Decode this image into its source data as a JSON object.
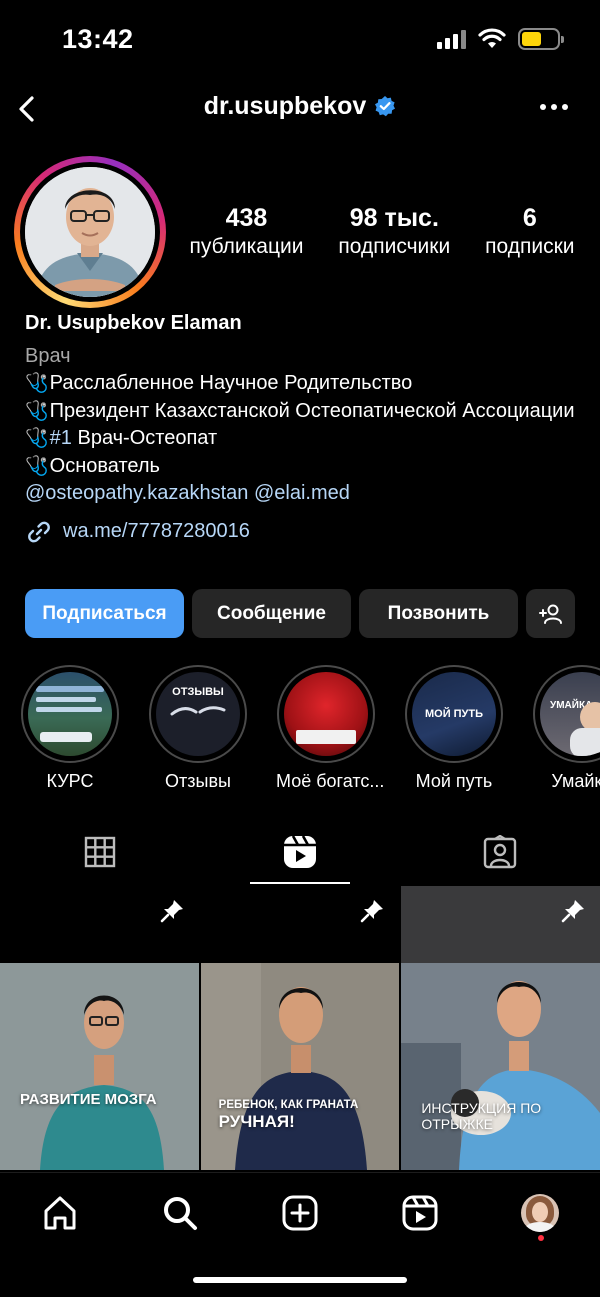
{
  "status": {
    "time": "13:42"
  },
  "header": {
    "username": "dr.usupbekov"
  },
  "stats": [
    {
      "value": "438",
      "label": "публикации"
    },
    {
      "value": "98 тыс.",
      "label": "подписчики"
    },
    {
      "value": "6",
      "label": "подписки"
    }
  ],
  "bio": {
    "name": "Dr. Usupbekov Elaman",
    "category": "Врач",
    "line1": "Расслабленное Научное Родительство",
    "line2": "Президент Казахстанской Остеопатической Ассоциации",
    "line3_tag": "#1",
    "line3_text": " Врач-Остеопат",
    "line4": "Основатель",
    "mention1": "@osteopathy.kazakhstan",
    "mention2": "@elai.med",
    "link": "wa.me/77787280016",
    "bullet": "🩺"
  },
  "buttons": {
    "follow": "Подписаться",
    "message": "Сообщение",
    "call": "Позвонить"
  },
  "highlights": [
    {
      "label": "КУРС",
      "caption": ""
    },
    {
      "label": "Отзывы",
      "caption": "ОТЗЫВЫ"
    },
    {
      "label": "Моё богатс...",
      "caption": ""
    },
    {
      "label": "Мой путь",
      "caption": "МОЙ ПУТЬ"
    },
    {
      "label": "Умайка",
      "caption": "УМАЙКА"
    }
  ],
  "reels": [
    {
      "caption": "РАЗВИТИЕ МОЗГА"
    },
    {
      "caption1": "РЕБЕНОК, КАК ГРАНАТА",
      "caption2": "РУЧНАЯ!"
    },
    {
      "caption1": "ИНСТРУКЦИЯ ПО",
      "caption2": "ОТРЫЖКЕ"
    }
  ],
  "colors": {
    "accent": "#4a9cf5",
    "verified": "#3897f0",
    "button_bg": "#262626",
    "notification": "#ff3040"
  },
  "icons": [
    "back-arrow-icon",
    "verified-badge-icon",
    "more-icon",
    "link-icon",
    "add-person-icon",
    "grid-icon",
    "reels-icon",
    "tagged-icon",
    "pin-icon",
    "home-icon",
    "search-icon",
    "create-icon",
    "reels-nav-icon"
  ]
}
